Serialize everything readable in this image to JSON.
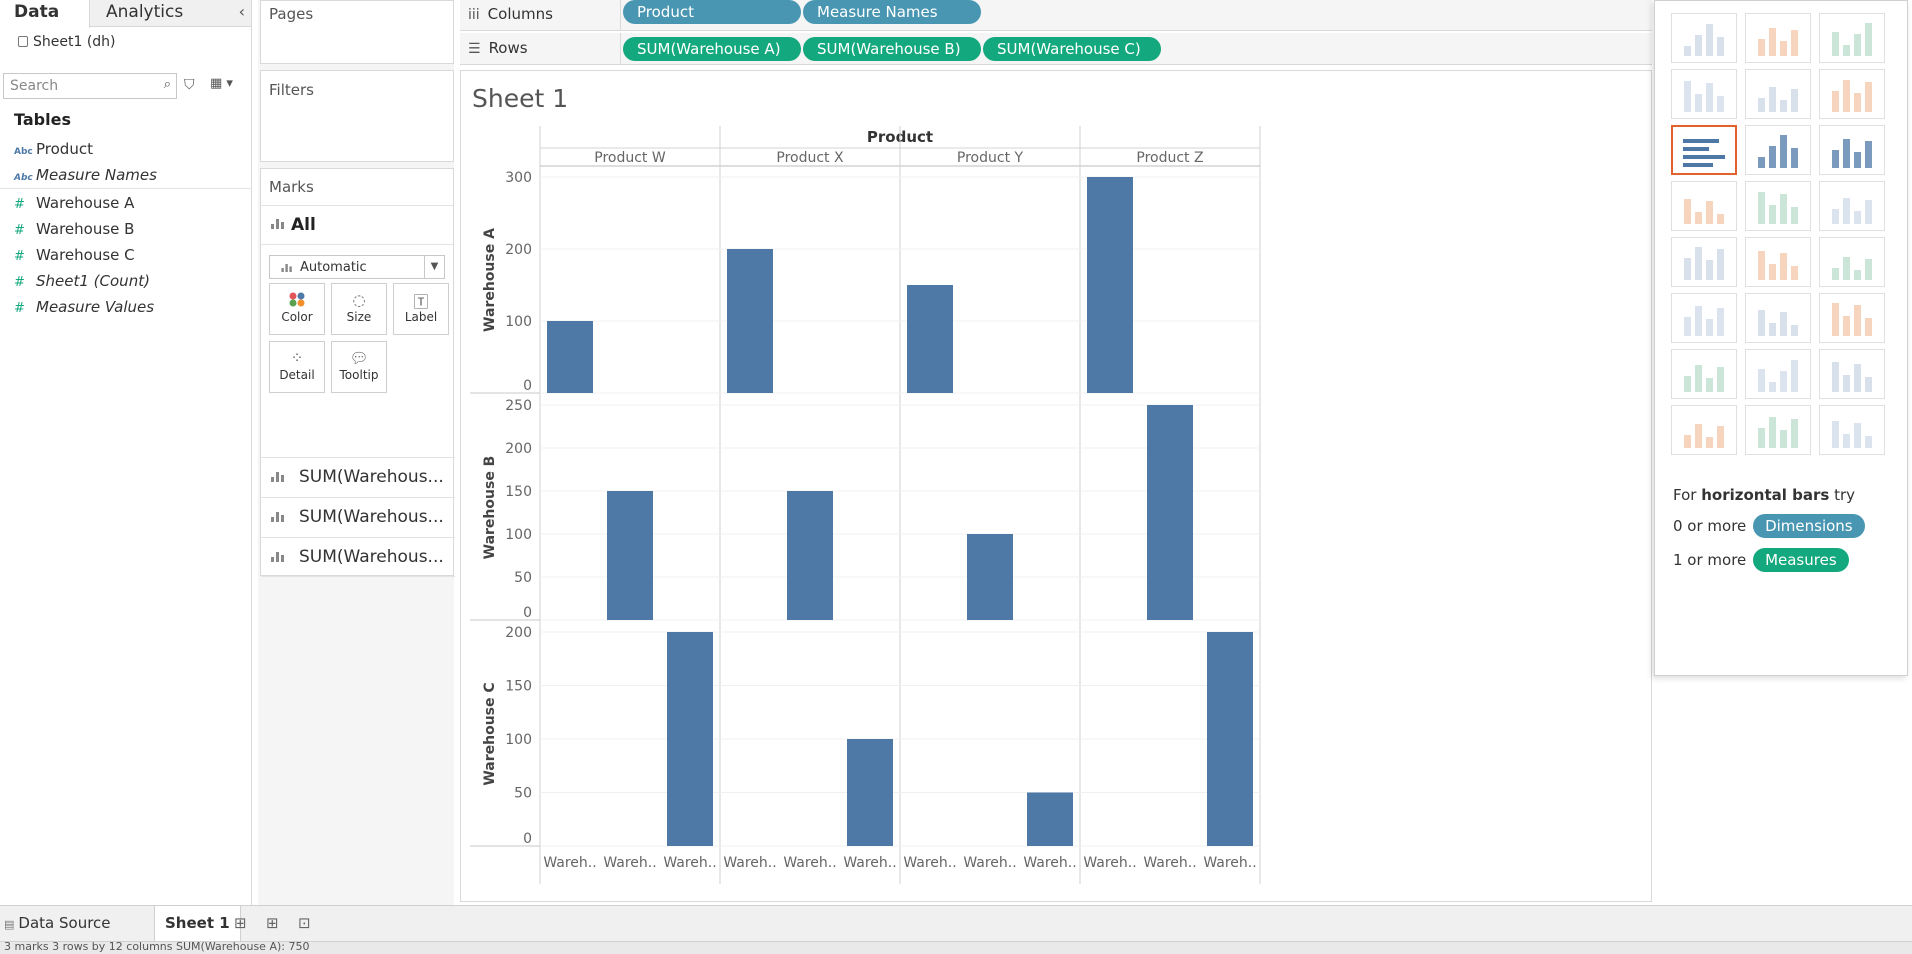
{
  "left_pane": {
    "tab_data": "Data",
    "tab_analytics": "Analytics",
    "collapse_glyph": "‹",
    "data_source": "Sheet1 (dh)",
    "search_placeholder": "Search",
    "tables_heading": "Tables",
    "fields": [
      {
        "type": "Abc",
        "name": "Product",
        "italic": false
      },
      {
        "type": "Abc",
        "name": "Measure Names",
        "italic": true
      },
      {
        "type": "#",
        "name": "Warehouse A",
        "italic": false
      },
      {
        "type": "#",
        "name": "Warehouse B",
        "italic": false
      },
      {
        "type": "#",
        "name": "Warehouse C",
        "italic": false
      },
      {
        "type": "#",
        "name": "Sheet1 (Count)",
        "italic": true
      },
      {
        "type": "#",
        "name": "Measure Values",
        "italic": true
      }
    ]
  },
  "cards": {
    "pages": "Pages",
    "filters": "Filters",
    "marks": "Marks",
    "marks_all": "All",
    "mark_type": "Automatic",
    "buttons": [
      "Color",
      "Size",
      "Label",
      "Detail",
      "Tooltip"
    ],
    "measure_pills": [
      "SUM(Warehous...",
      "SUM(Warehous...",
      "SUM(Warehous..."
    ]
  },
  "shelves": {
    "columns_label": "Columns",
    "rows_label": "Rows",
    "columns_pills": [
      "Product",
      "Measure Names"
    ],
    "rows_pills": [
      "SUM(Warehouse A)",
      "SUM(Warehouse B)",
      "SUM(Warehouse C)"
    ]
  },
  "sheet": {
    "title": "Sheet 1"
  },
  "chart_data": {
    "type": "bar",
    "column_header": "Product",
    "products": [
      "Product W",
      "Product X",
      "Product Y",
      "Product Z"
    ],
    "measure_names_labels": [
      "Wareh..",
      "Wareh..",
      "Wareh.."
    ],
    "rows": [
      {
        "label": "Warehouse A",
        "ylim": [
          0,
          300
        ],
        "ticks": [
          0,
          100,
          200,
          300
        ],
        "values": [
          [
            100,
            null,
            null
          ],
          [
            200,
            null,
            null
          ],
          [
            150,
            null,
            null
          ],
          [
            300,
            null,
            null
          ]
        ]
      },
      {
        "label": "Warehouse B",
        "ylim": [
          0,
          250
        ],
        "ticks": [
          0,
          50,
          100,
          150,
          200,
          250
        ],
        "values": [
          [
            null,
            150,
            null
          ],
          [
            null,
            150,
            null
          ],
          [
            null,
            100,
            null
          ],
          [
            null,
            250,
            null
          ]
        ]
      },
      {
        "label": "Warehouse C",
        "ylim": [
          0,
          200
        ],
        "ticks": [
          0,
          50,
          100,
          150,
          200
        ],
        "values": [
          [
            null,
            null,
            200
          ],
          [
            null,
            null,
            100
          ],
          [
            null,
            null,
            50
          ],
          [
            null,
            null,
            200
          ]
        ]
      }
    ],
    "bar_color": "#4e79a7"
  },
  "show_me": {
    "hint_prefix": "For",
    "hint_type": "horizontal bars",
    "hint_suffix": "try",
    "dims_prefix": "0 or more",
    "dims_pill": "Dimensions",
    "meas_prefix": "1 or more",
    "meas_pill": "Measures",
    "selected_color": "#e2622d"
  },
  "bottom": {
    "data_source_tab": "Data Source",
    "sheet_tab": "Sheet 1",
    "status": "3 marks   3 rows by 12 columns   SUM(Warehouse A): 750"
  }
}
